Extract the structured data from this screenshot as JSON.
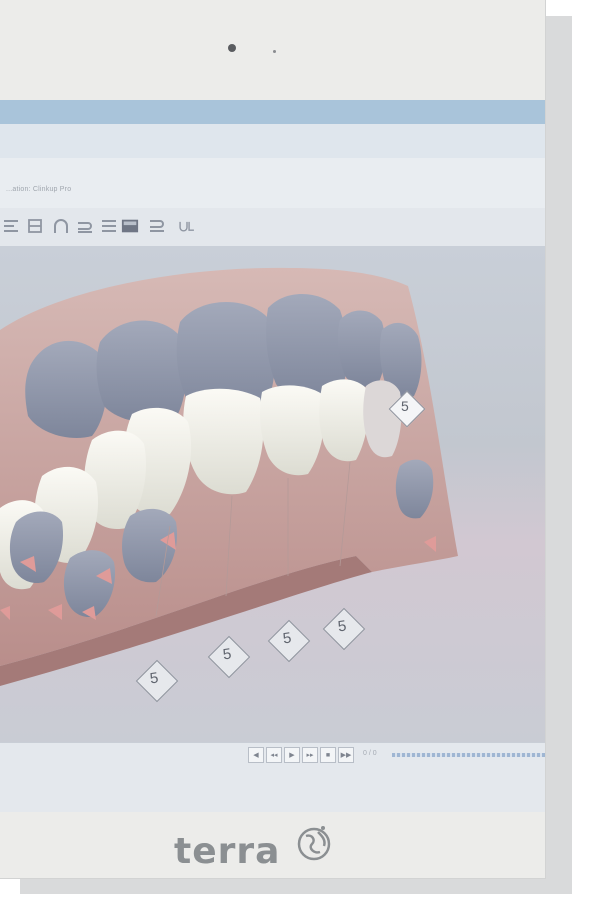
{
  "monitor": {
    "brand": "terra"
  },
  "app": {
    "subtitle": "...ation: Clinkup Pro",
    "frame_label": "0 / 0"
  },
  "toolbar": {
    "icons": [
      "arch-icon",
      "split-view-icon",
      "upper-arch-icon",
      "jaw-icon",
      "panel-icon",
      "lower-view-icon",
      "u-view-icon"
    ]
  },
  "viewport": {
    "tooth_labels": [
      "5",
      "5",
      "5",
      "5"
    ],
    "top_label": "5"
  },
  "navigation": {
    "buttons": [
      "first-frame",
      "previous-frame",
      "play",
      "next-frame",
      "last-frame"
    ]
  },
  "colors": {
    "gum": "#c9a7a5",
    "tooth": "#f1f0ea",
    "selected_tooth": "#8e95a9",
    "marker": "#df9b99"
  }
}
